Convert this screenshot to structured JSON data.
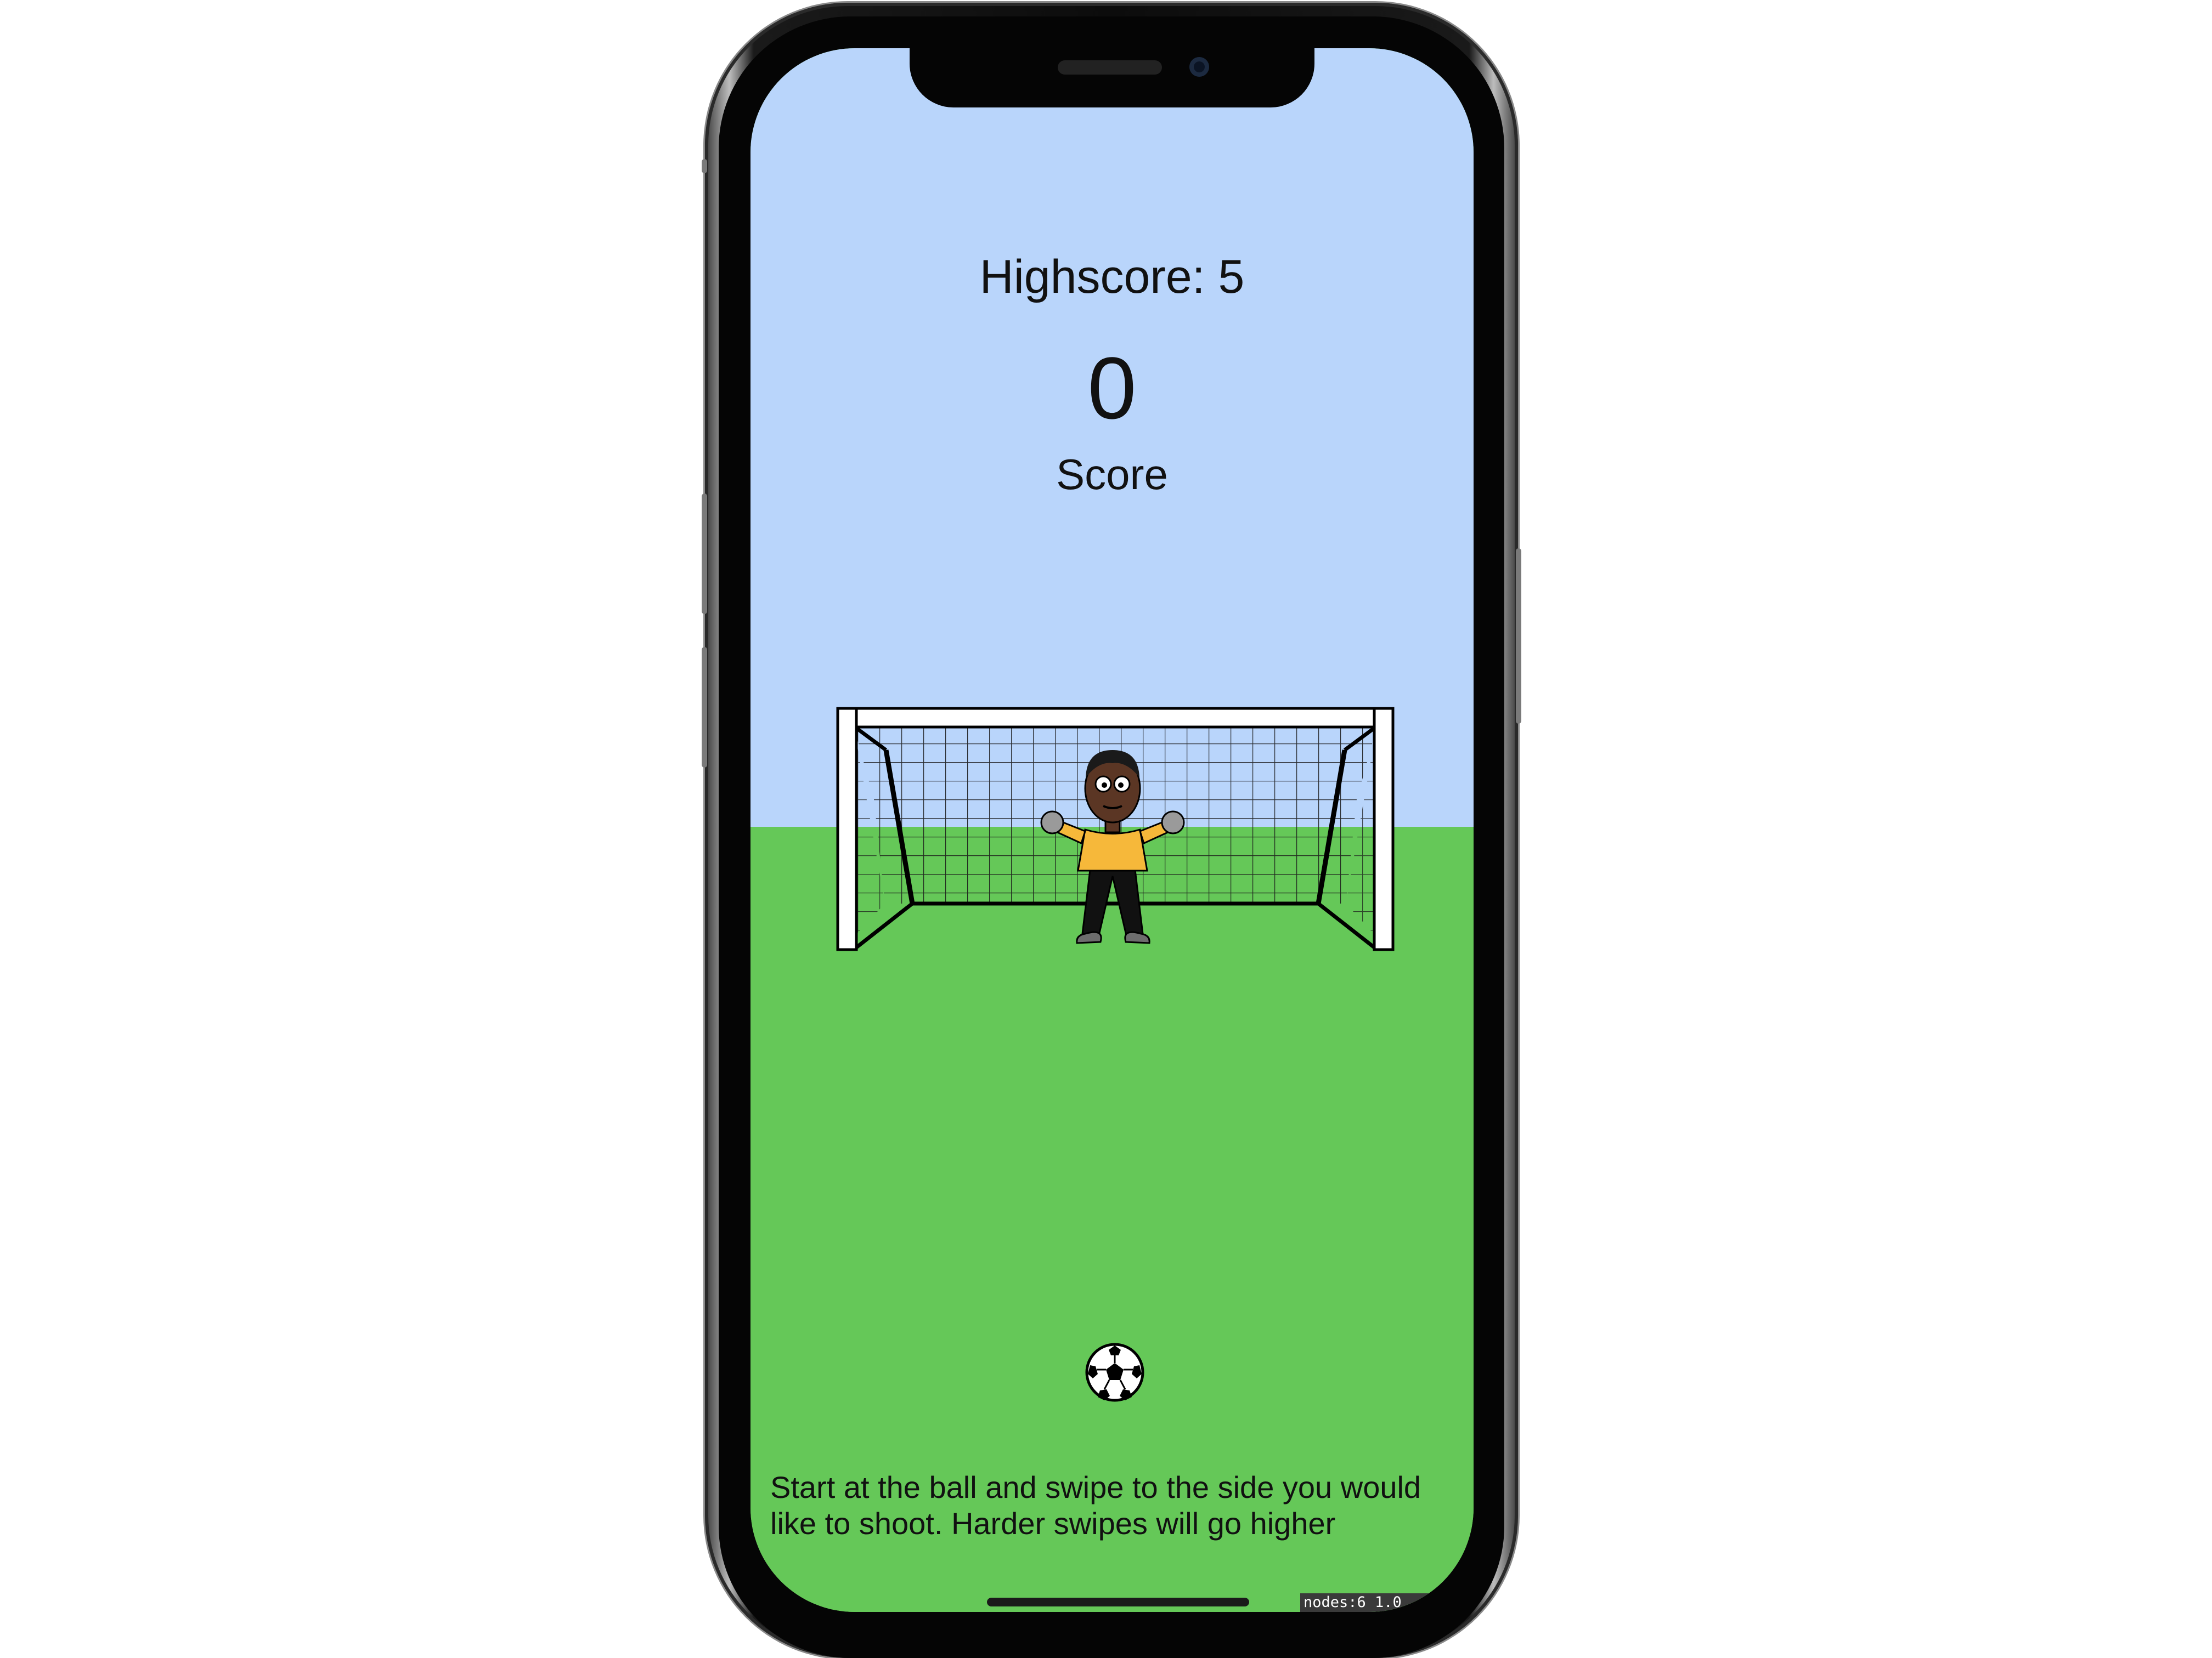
{
  "hud": {
    "highscore_label": "Highscore: 5",
    "score_value": "0",
    "score_label": "Score"
  },
  "instructions": "Start at the ball and swipe to the side you would like to shoot.  Harder swipes will go higher",
  "debug_overlay": "nodes:6  1.0",
  "colors": {
    "sky": "#b9d5fb",
    "grass": "#65c858",
    "jersey": "#f6b83a"
  }
}
